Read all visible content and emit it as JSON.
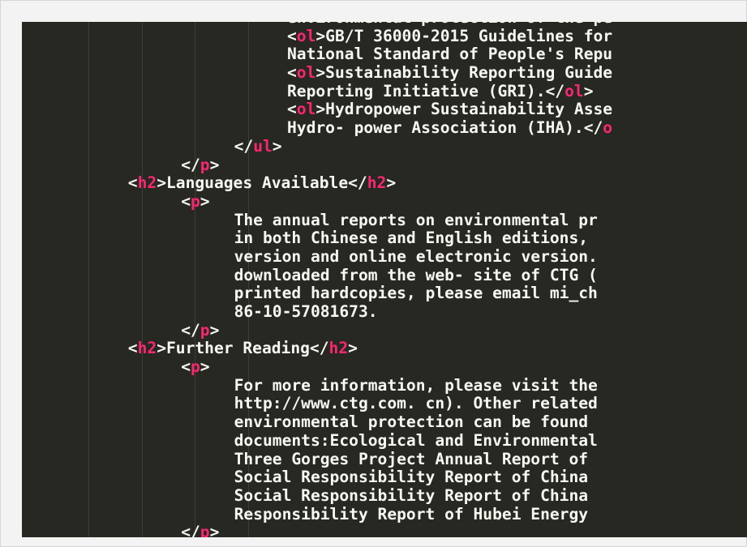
{
  "editor": {
    "lines": [
      {
        "indent": 20,
        "parts": [
          {
            "t": "environmental protection of the pe",
            "c": "b"
          }
        ]
      },
      {
        "indent": 20,
        "parts": [
          {
            "t": "<",
            "c": "b"
          },
          {
            "t": "ol",
            "c": "tag"
          },
          {
            "t": ">GB/T 36000-2015 Guidelines for",
            "c": "b"
          }
        ]
      },
      {
        "indent": 20,
        "parts": [
          {
            "t": "National Standard of People's Repu",
            "c": "b"
          }
        ]
      },
      {
        "indent": 20,
        "parts": [
          {
            "t": "<",
            "c": "b"
          },
          {
            "t": "ol",
            "c": "tag"
          },
          {
            "t": ">Sustainability Reporting Guide",
            "c": "b"
          }
        ]
      },
      {
        "indent": 20,
        "parts": [
          {
            "t": "Reporting Initiative (GRI).</",
            "c": "b"
          },
          {
            "t": "ol",
            "c": "tag"
          },
          {
            "t": ">",
            "c": "b"
          }
        ]
      },
      {
        "indent": 20,
        "parts": [
          {
            "t": "<",
            "c": "b"
          },
          {
            "t": "ol",
            "c": "tag"
          },
          {
            "t": ">Hydropower Sustainability Asse",
            "c": "b"
          }
        ]
      },
      {
        "indent": 20,
        "parts": [
          {
            "t": "Hydro- power Association (IHA).</",
            "c": "b"
          },
          {
            "t": "o",
            "c": "tag"
          }
        ]
      },
      {
        "indent": 16,
        "parts": [
          {
            "t": "</",
            "c": "b"
          },
          {
            "t": "ul",
            "c": "tag"
          },
          {
            "t": ">",
            "c": "b"
          }
        ]
      },
      {
        "indent": 12,
        "parts": [
          {
            "t": "</",
            "c": "b"
          },
          {
            "t": "p",
            "c": "tag"
          },
          {
            "t": ">",
            "c": "b"
          }
        ]
      },
      {
        "indent": 8,
        "parts": [
          {
            "t": "<",
            "c": "b"
          },
          {
            "t": "h2",
            "c": "tag"
          },
          {
            "t": ">Languages Available</",
            "c": "b"
          },
          {
            "t": "h2",
            "c": "tag"
          },
          {
            "t": ">",
            "c": "b"
          }
        ]
      },
      {
        "indent": 12,
        "parts": [
          {
            "t": "<",
            "c": "b"
          },
          {
            "t": "p",
            "c": "tag"
          },
          {
            "t": ">",
            "c": "b"
          }
        ]
      },
      {
        "indent": 16,
        "parts": [
          {
            "t": "The annual reports on environmental pr",
            "c": "b"
          }
        ]
      },
      {
        "indent": 16,
        "parts": [
          {
            "t": "in both Chinese and English editions,",
            "c": "b"
          }
        ]
      },
      {
        "indent": 16,
        "parts": [
          {
            "t": "version and online electronic version.",
            "c": "b"
          }
        ]
      },
      {
        "indent": 16,
        "parts": [
          {
            "t": "downloaded from the web- site of CTG (",
            "c": "b"
          }
        ]
      },
      {
        "indent": 16,
        "parts": [
          {
            "t": "printed hardcopies, please email mi_ch",
            "c": "b"
          }
        ]
      },
      {
        "indent": 16,
        "parts": [
          {
            "t": "86-10-57081673.",
            "c": "b"
          }
        ]
      },
      {
        "indent": 12,
        "parts": [
          {
            "t": "</",
            "c": "b"
          },
          {
            "t": "p",
            "c": "tag"
          },
          {
            "t": ">",
            "c": "b"
          }
        ]
      },
      {
        "indent": 8,
        "parts": [
          {
            "t": "<",
            "c": "b"
          },
          {
            "t": "h2",
            "c": "tag"
          },
          {
            "t": ">Further Reading</",
            "c": "b"
          },
          {
            "t": "h2",
            "c": "tag"
          },
          {
            "t": ">",
            "c": "b"
          }
        ]
      },
      {
        "indent": 12,
        "parts": [
          {
            "t": "<",
            "c": "b"
          },
          {
            "t": "p",
            "c": "tag"
          },
          {
            "t": ">",
            "c": "b"
          }
        ]
      },
      {
        "indent": 16,
        "parts": [
          {
            "t": "For more information, please visit the",
            "c": "b"
          }
        ]
      },
      {
        "indent": 16,
        "parts": [
          {
            "t": "http://www.ctg.com. cn). Other related",
            "c": "b"
          }
        ]
      },
      {
        "indent": 16,
        "parts": [
          {
            "t": "environmental protection can be found",
            "c": "b"
          }
        ]
      },
      {
        "indent": 16,
        "parts": [
          {
            "t": "documents:Ecological and Environmental",
            "c": "b"
          }
        ]
      },
      {
        "indent": 16,
        "parts": [
          {
            "t": "Three Gorges Project Annual Report of",
            "c": "b"
          }
        ]
      },
      {
        "indent": 16,
        "parts": [
          {
            "t": "Social Responsibility Report of China",
            "c": "b"
          }
        ]
      },
      {
        "indent": 16,
        "parts": [
          {
            "t": "Social Responsibility Report of China",
            "c": "b"
          }
        ]
      },
      {
        "indent": 16,
        "parts": [
          {
            "t": "Responsibility Report of Hubei Energy",
            "c": "b"
          }
        ]
      },
      {
        "indent": 12,
        "parts": [
          {
            "t": "</",
            "c": "b"
          },
          {
            "t": "p",
            "c": "tag"
          },
          {
            "t": ">",
            "c": "b"
          }
        ]
      }
    ]
  },
  "colors": {
    "background": "#272822",
    "text": "#f8f8f2",
    "tag": "#f92672"
  }
}
